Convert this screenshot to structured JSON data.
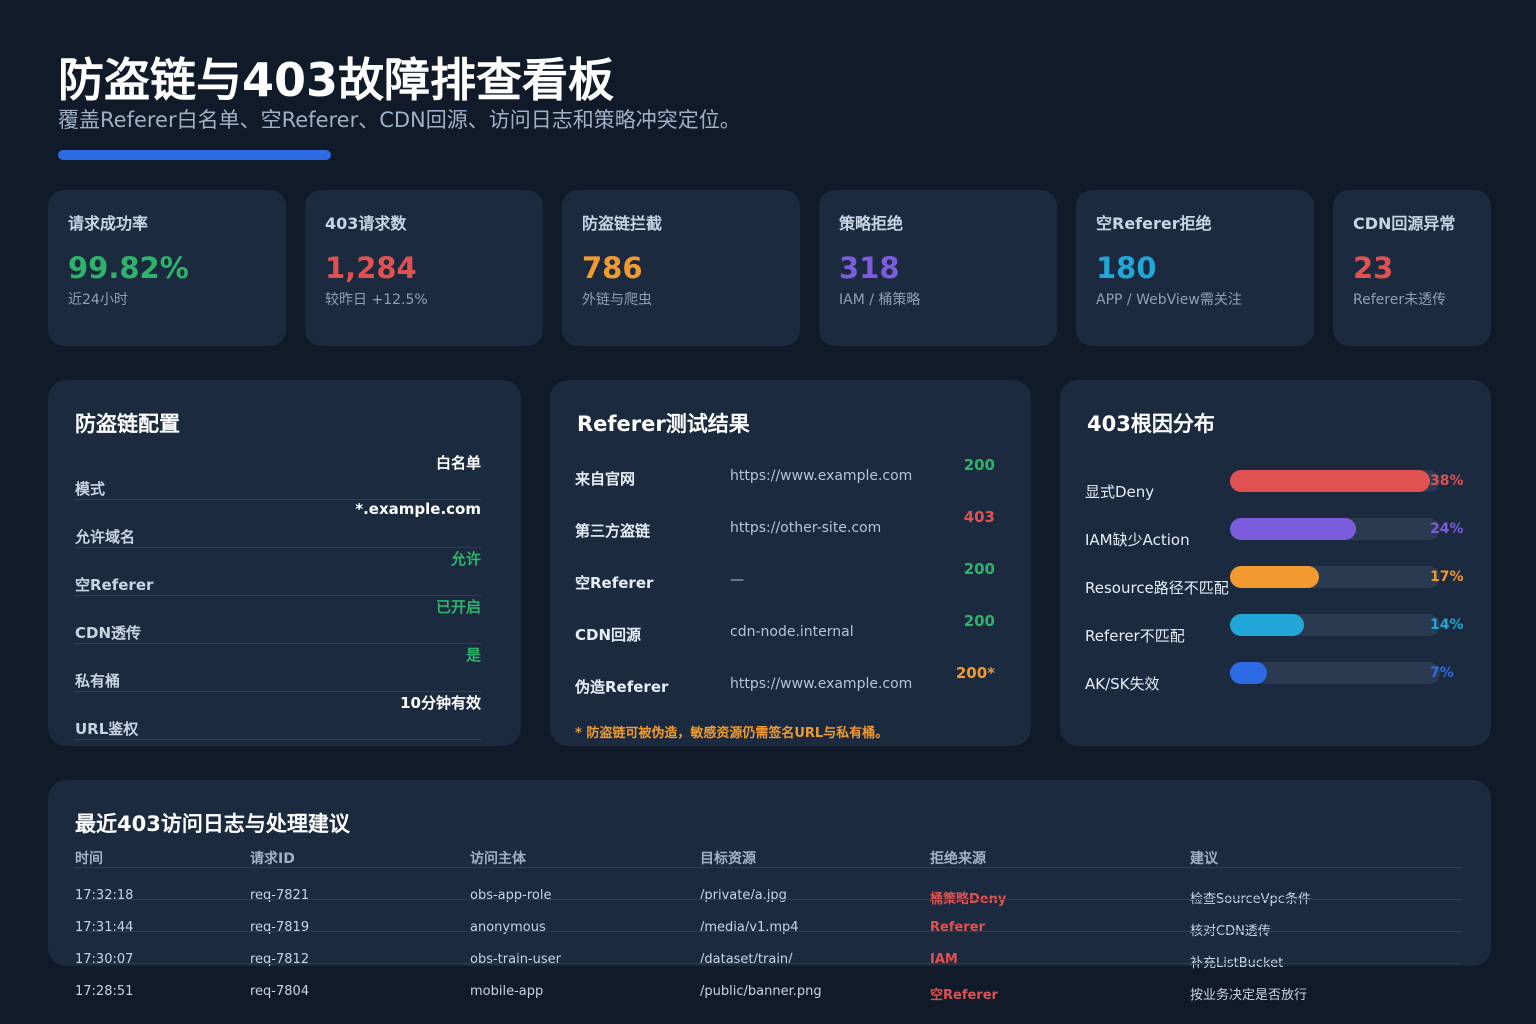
{
  "header": {
    "title": "防盗链与403故障排查看板",
    "subtitle": "覆盖Referer白名单、空Referer、CDN回源、访问日志和策略冲突定位。"
  },
  "kpis": [
    {
      "label": "请求成功率",
      "value": "99.82%",
      "sub": "近24小时",
      "color": "#2fb36b"
    },
    {
      "label": "403请求数",
      "value": "1,284",
      "sub": "较昨日 +12.5%",
      "color": "#e05252"
    },
    {
      "label": "防盗链拦截",
      "value": "786",
      "sub": "外链与爬虫",
      "color": "#f09a30"
    },
    {
      "label": "策略拒绝",
      "value": "318",
      "sub": "IAM / 桶策略",
      "color": "#7a5cdc"
    },
    {
      "label": "空Referer拒绝",
      "value": "180",
      "sub": "APP / WebView需关注",
      "color": "#22a6d8"
    },
    {
      "label": "CDN回源异常",
      "value": "23",
      "sub": "Referer未透传",
      "color": "#e05252"
    }
  ],
  "config": {
    "title": "防盗链配置",
    "rows": [
      {
        "key": "模式",
        "value": "白名单",
        "color": "#ffffff"
      },
      {
        "key": "允许域名",
        "value": "*.example.com",
        "color": "#ffffff"
      },
      {
        "key": "空Referer",
        "value": "允许",
        "color": "#2fb36b"
      },
      {
        "key": "CDN透传",
        "value": "已开启",
        "color": "#2fb36b"
      },
      {
        "key": "私有桶",
        "value": "是",
        "color": "#2fb36b"
      },
      {
        "key": "URL鉴权",
        "value": "10分钟有效",
        "color": "#ffffff"
      }
    ]
  },
  "referer_test": {
    "title": "Referer测试结果",
    "rows": [
      {
        "name": "来自官网",
        "url": "https://www.example.com",
        "code": "200",
        "color": "#2fb36b"
      },
      {
        "name": "第三方盗链",
        "url": "https://other-site.com",
        "code": "403",
        "color": "#e05252"
      },
      {
        "name": "空Referer",
        "url": "—",
        "code": "200",
        "color": "#2fb36b"
      },
      {
        "name": "CDN回源",
        "url": "cdn-node.internal",
        "code": "200",
        "color": "#2fb36b"
      },
      {
        "name": "伪造Referer",
        "url": "https://www.example.com",
        "code": "200*",
        "color": "#f09a30"
      }
    ],
    "note": "* 防盗链可被伪造，敏感资源仍需签名URL与私有桶。"
  },
  "root_cause": {
    "title": "403根因分布",
    "rows": [
      {
        "name": "显式Deny",
        "value": 38,
        "label": "38%",
        "color": "#e05252"
      },
      {
        "name": "IAM缺少Action",
        "value": 24,
        "label": "24%",
        "color": "#7a5cdc"
      },
      {
        "name": "Resource路径不匹配",
        "value": 17,
        "label": "17%",
        "color": "#f09a30"
      },
      {
        "name": "Referer不匹配",
        "value": 14,
        "label": "14%",
        "color": "#22a6d8"
      },
      {
        "name": "AK/SK失效",
        "value": 7,
        "label": "7%",
        "color": "#2d6be4"
      }
    ]
  },
  "logs": {
    "title": "最近403访问日志与处理建议",
    "columns": [
      "时间",
      "请求ID",
      "访问主体",
      "目标资源",
      "拒绝来源",
      "建议"
    ],
    "rows": [
      [
        "17:32:18",
        "req-7821",
        "obs-app-role",
        "/private/a.jpg",
        "桶策略Deny",
        "检查SourceVpc条件"
      ],
      [
        "17:31:44",
        "req-7819",
        "anonymous",
        "/media/v1.mp4",
        "Referer",
        "核对CDN透传"
      ],
      [
        "17:30:07",
        "req-7812",
        "obs-train-user",
        "/dataset/train/",
        "IAM",
        "补充ListBucket"
      ],
      [
        "17:28:51",
        "req-7804",
        "mobile-app",
        "/public/banner.png",
        "空Referer",
        "按业务决定是否放行"
      ]
    ]
  }
}
